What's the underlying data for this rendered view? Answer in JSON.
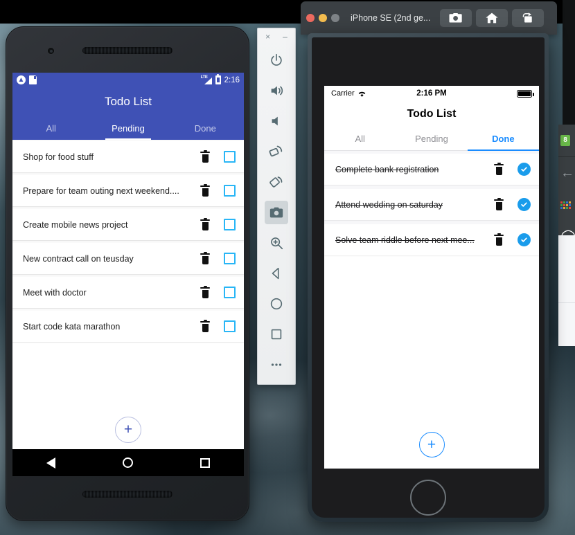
{
  "colors": {
    "android_primary": "#3f51b5",
    "android_checkbox": "#29b6f6",
    "ios_accent": "#1a8cff",
    "ios_check": "#1a9ceb",
    "desktop_bg": "#2d4049"
  },
  "android": {
    "status_bar": {
      "app_icon": "app-icon",
      "sd_icon": "sd-card-icon",
      "network_label": "LTE",
      "signal_icon": "signal-icon",
      "battery_icon": "battery-icon",
      "clock": "2:16"
    },
    "appbar": {
      "title": "Todo List"
    },
    "tabs": [
      {
        "label": "All",
        "active": false
      },
      {
        "label": "Pending",
        "active": true
      },
      {
        "label": "Done",
        "active": false
      }
    ],
    "items": [
      {
        "text": "Shop for food stuff",
        "done": false
      },
      {
        "text": "Prepare for team outing next weekend....",
        "done": false
      },
      {
        "text": "Create mobile news project",
        "done": false
      },
      {
        "text": "New contract call on teusday",
        "done": false
      },
      {
        "text": "Meet with doctor",
        "done": false
      },
      {
        "text": "Start code kata marathon",
        "done": false
      }
    ],
    "fab": {
      "label": "+"
    },
    "navbar": {
      "back": "back-icon",
      "home": "home-icon",
      "recents": "recents-icon"
    }
  },
  "emulator_toolbar": {
    "close": "×",
    "minimize": "–",
    "buttons": [
      {
        "name": "power-icon"
      },
      {
        "name": "volume-up-icon"
      },
      {
        "name": "volume-down-icon"
      },
      {
        "name": "rotate-left-icon"
      },
      {
        "name": "rotate-right-icon"
      },
      {
        "name": "screenshot-icon",
        "active": true
      },
      {
        "name": "zoom-icon"
      },
      {
        "name": "back-icon"
      },
      {
        "name": "home-icon"
      },
      {
        "name": "overview-icon"
      },
      {
        "name": "more-icon"
      }
    ]
  },
  "ios_window": {
    "title": "iPhone SE (2nd ge...",
    "buttons": [
      {
        "name": "screenshot-button",
        "glyph": "camera-icon"
      },
      {
        "name": "home-button",
        "glyph": "home-icon"
      },
      {
        "name": "rotate-button",
        "glyph": "rotate-icon"
      }
    ]
  },
  "ios": {
    "status_bar": {
      "carrier": "Carrier",
      "wifi_icon": "wifi-icon",
      "time": "2:16 PM",
      "battery_icon": "battery-icon"
    },
    "appbar": {
      "title": "Todo List"
    },
    "tabs": [
      {
        "label": "All",
        "active": false
      },
      {
        "label": "Pending",
        "active": false
      },
      {
        "label": "Done",
        "active": true
      }
    ],
    "items": [
      {
        "text": "Complete bank registration",
        "done": true
      },
      {
        "text": "Attend wedding on saturday",
        "done": true
      },
      {
        "text": "Solve team riddle before next mee...",
        "done": true
      }
    ],
    "fab": {
      "label": "+"
    }
  },
  "edge_dock": {
    "items": [
      {
        "name": "green-app-icon",
        "glyph": "8"
      },
      {
        "name": "back-arrow-icon",
        "glyph": "←"
      },
      {
        "name": "apps-grid-icon",
        "glyph": ""
      },
      {
        "name": "circle-app-icon",
        "glyph": "◯"
      }
    ]
  }
}
